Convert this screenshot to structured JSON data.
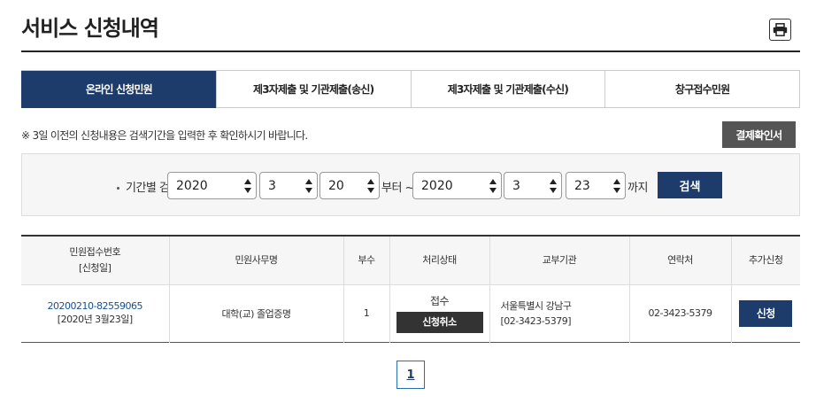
{
  "page": {
    "title": "서비스 신청내역",
    "print_icon": "printer-icon"
  },
  "tabs": [
    {
      "label": "온라인 신청민원",
      "active": true
    },
    {
      "label": "제3자제출 및 기관제출(송신)",
      "active": false
    },
    {
      "label": "제3자제출 및 기관제출(수신)",
      "active": false
    },
    {
      "label": "창구접수민원",
      "active": false
    }
  ],
  "notice": "※ 3일 이전의 신청내용은 검색기간을 입력한 후 확인하시기 바랍니다.",
  "confirm_button": "결제확인서",
  "search": {
    "label": "기간별 검색",
    "from_year": "2020",
    "from_month": "3",
    "from_day": "20",
    "from_text": "부터 ~",
    "to_year": "2020",
    "to_month": "3",
    "to_day": "23",
    "to_text": "까지",
    "button": "검색"
  },
  "table": {
    "headers": {
      "receipt_no": "민원접수번호",
      "receipt_sub": "[신청일]",
      "task": "민원사무명",
      "copies": "부수",
      "status": "처리상태",
      "org": "교부기관",
      "contact": "연락처",
      "extra": "추가신청"
    },
    "rows": [
      {
        "receipt_no": "20200210-82559065",
        "date": "[2020년 3월23일]",
        "task": "대학(교) 졸업증명",
        "copies": "1",
        "status": "접수",
        "cancel_button": "신청취소",
        "org_name": "서울특별시 강남구",
        "org_phone": "[02-3423-5379]",
        "contact": "02-3423-5379",
        "apply_button": "신청"
      }
    ]
  },
  "pagination": {
    "current": "1"
  },
  "colors": {
    "primary": "#1d3c6c",
    "dark_button": "#555555",
    "link": "#1a4f8a"
  }
}
